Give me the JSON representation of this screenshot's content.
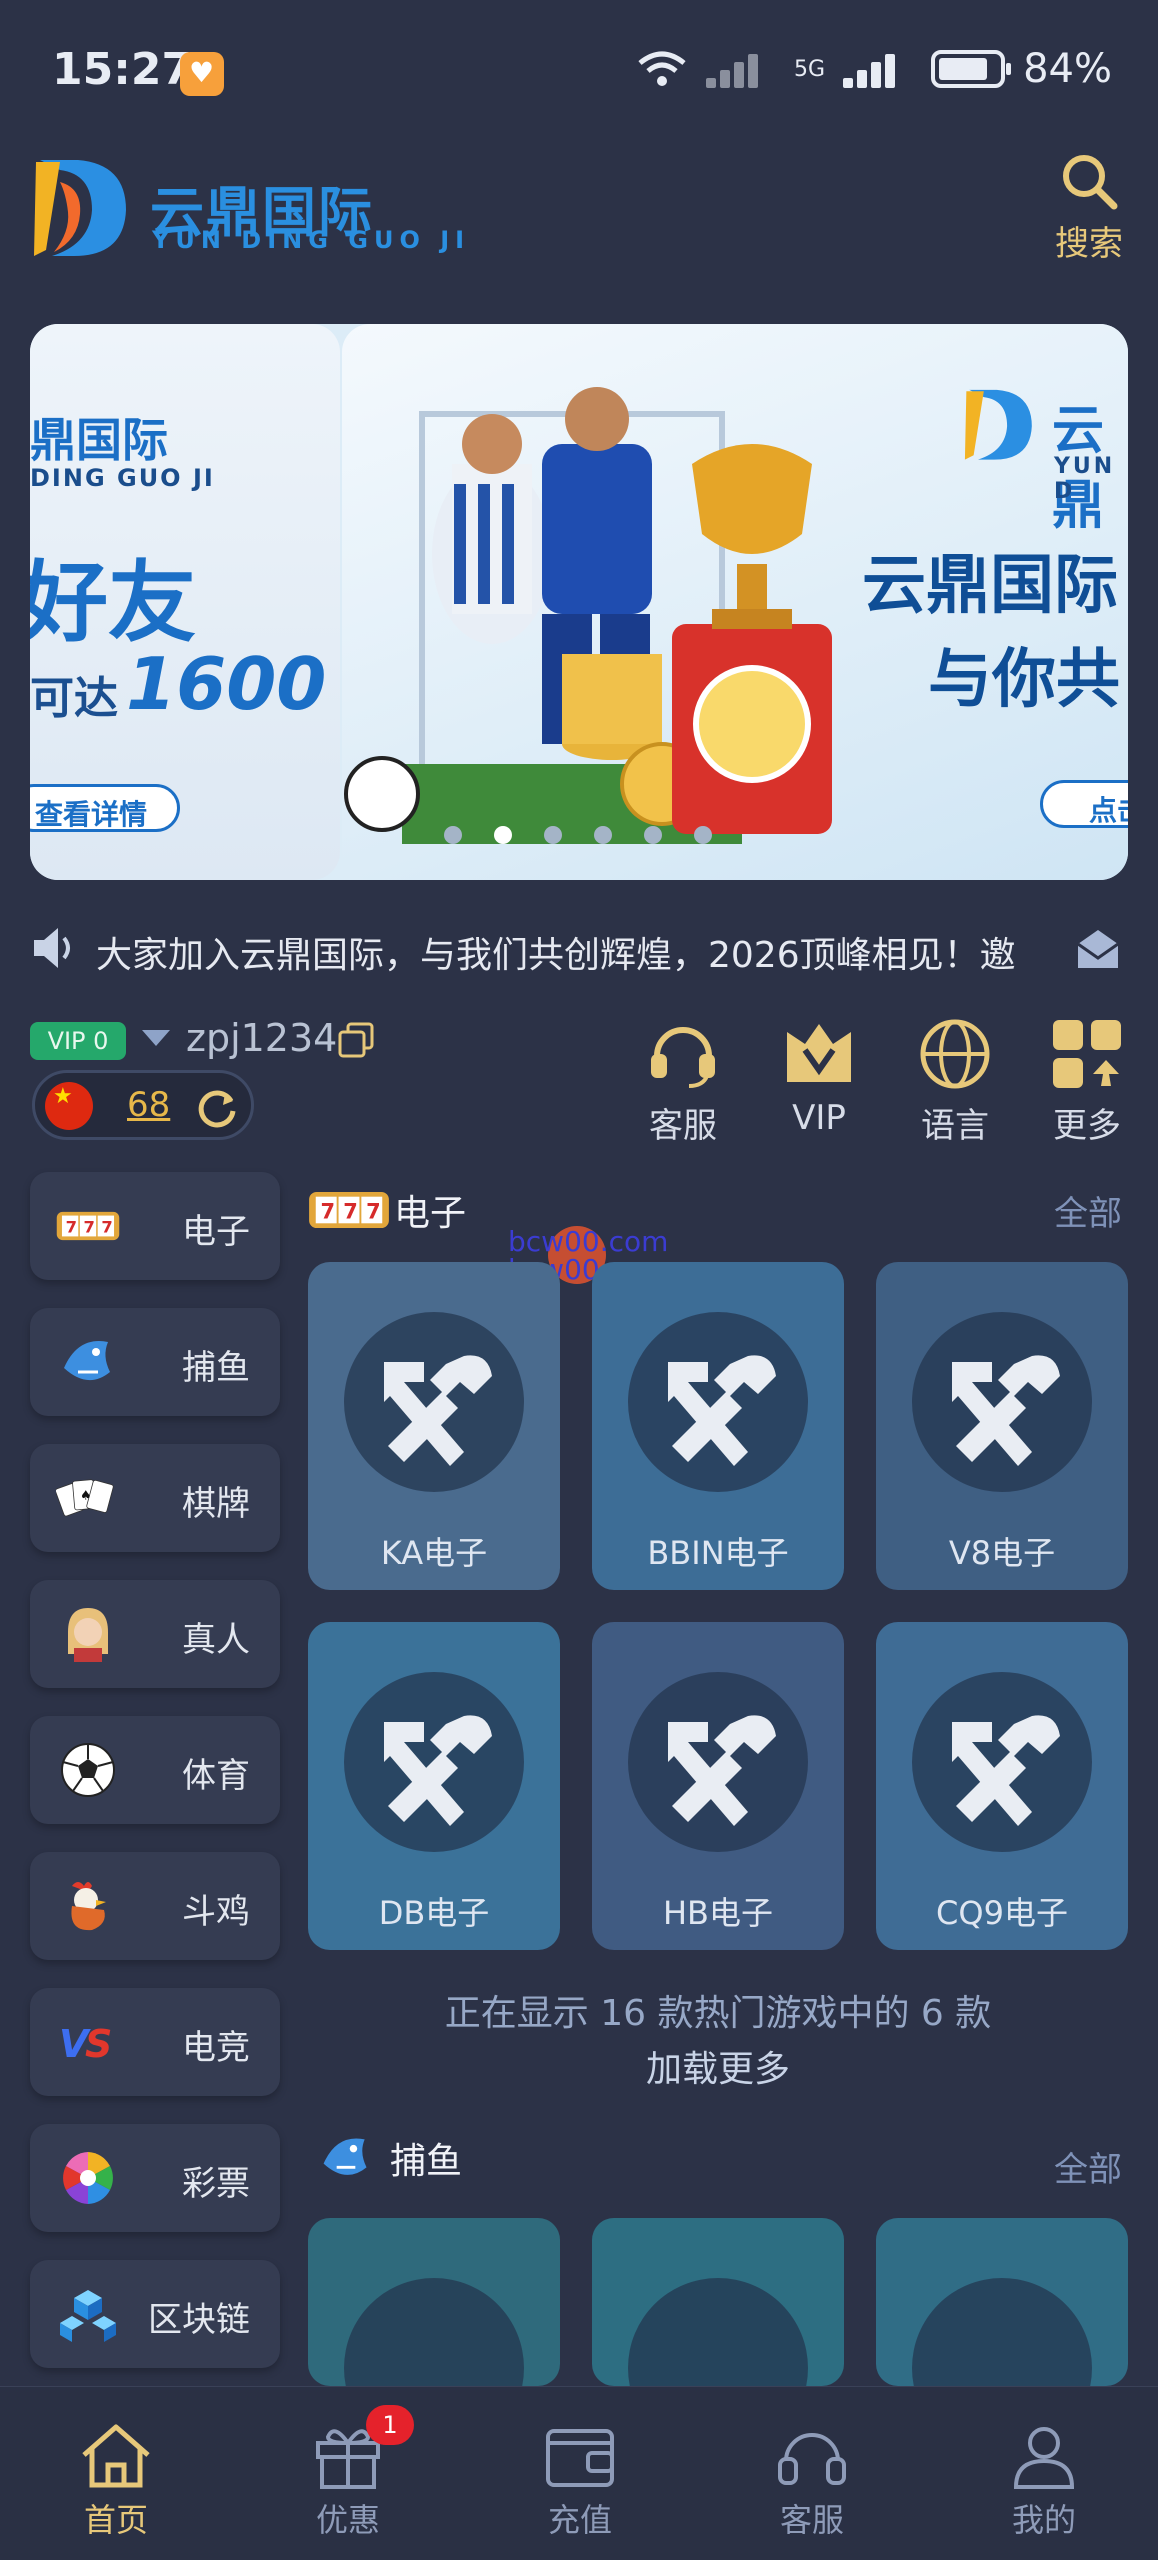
{
  "status_bar": {
    "time": "15:27",
    "network": "5G",
    "battery": "84%"
  },
  "header": {
    "logo_cn": "云鼎国际",
    "logo_en": "YUN DING GUO JI",
    "search_label": "搜索"
  },
  "banner": {
    "left_slide": {
      "brand_cn": "鼎国际",
      "brand_en": "DING GUO JI",
      "headline": "好友",
      "amount_prefix": "可达",
      "amount": "1600",
      "button": "查看详情"
    },
    "right_slide": {
      "brand_cn": "云鼎",
      "brand_en": "YUN D",
      "headline_1": "云鼎国际",
      "headline_2": "与你共",
      "button": "点击"
    },
    "dots_count": 6,
    "active_dot": 1
  },
  "marquee": {
    "text": "大家加入云鼎国际，与我们共创辉煌，2026顶峰相见！邀"
  },
  "user": {
    "vip_level": "VIP 0",
    "username": "zpj1234",
    "balance": "68"
  },
  "quick_actions": [
    {
      "label": "客服",
      "icon": "headset-icon"
    },
    {
      "label": "VIP",
      "icon": "vip-crown-icon"
    },
    {
      "label": "语言",
      "icon": "globe-icon"
    },
    {
      "label": "更多",
      "icon": "grid-icon"
    }
  ],
  "categories": [
    {
      "label": "电子",
      "icon": "slot-777-icon"
    },
    {
      "label": "捕鱼",
      "icon": "shark-icon"
    },
    {
      "label": "棋牌",
      "icon": "playing-cards-icon"
    },
    {
      "label": "真人",
      "icon": "dealer-icon"
    },
    {
      "label": "体育",
      "icon": "soccer-ball-icon"
    },
    {
      "label": "斗鸡",
      "icon": "rooster-icon"
    },
    {
      "label": "电竞",
      "icon": "vs-icon"
    },
    {
      "label": "彩票",
      "icon": "lottery-icon"
    },
    {
      "label": "区块链",
      "icon": "blockchain-icon"
    }
  ],
  "section_electronic": {
    "title": "电子",
    "all_label": "全部",
    "games": [
      {
        "name": "KA电子",
        "color": "#4a6b8e"
      },
      {
        "name": "BBIN电子",
        "color": "#3d6d96"
      },
      {
        "name": "V8电子",
        "color": "#3f5f83"
      },
      {
        "name": "DB电子",
        "color": "#3b7299"
      },
      {
        "name": "HB电子",
        "color": "#405b82"
      },
      {
        "name": "CQ9电子",
        "color": "#3f6c95"
      }
    ],
    "info": "正在显示 16 款热门游戏中的 6 款",
    "load_more": "加载更多"
  },
  "section_fishing": {
    "title": "捕鱼",
    "all_label": "全部"
  },
  "watermark": {
    "line1": "bcw00.com",
    "line2": "bcw00.xyz"
  },
  "bottom_nav": [
    {
      "label": "首页",
      "icon": "home-icon",
      "active": true
    },
    {
      "label": "优惠",
      "icon": "gift-icon",
      "badge": "1"
    },
    {
      "label": "充值",
      "icon": "wallet-icon"
    },
    {
      "label": "客服",
      "icon": "headset-icon"
    },
    {
      "label": "我的",
      "icon": "profile-icon"
    }
  ]
}
